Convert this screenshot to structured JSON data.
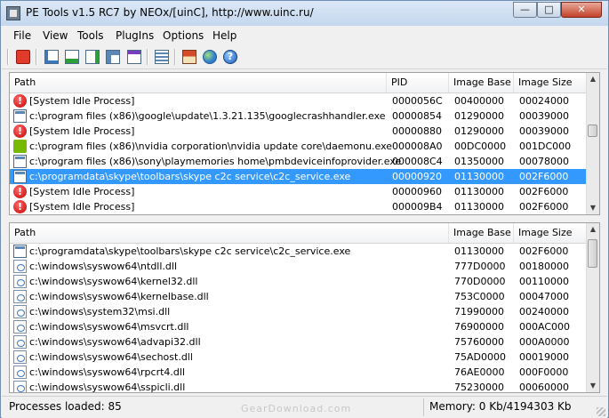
{
  "window": {
    "title": "PE Tools v1.5 RC7 by NEOx/[uinC], http://www.uinc.ru/",
    "minimize": "—",
    "maximize": "□",
    "close": "✕"
  },
  "menu": [
    "File",
    "View",
    "Tools",
    "PlugIns",
    "Options",
    "Help"
  ],
  "toolbar_icons": [
    "exit-icon",
    "edit-icon",
    "dump-icon",
    "rebuild-icon",
    "break-icon",
    "pe-editor-icon",
    "list-icon",
    "home-icon",
    "globe-icon",
    "help-icon"
  ],
  "process_list": {
    "headers": [
      "Path",
      "PID",
      "Image Base",
      "Image Size"
    ],
    "rows": [
      {
        "icon": "system-icon",
        "path": "[System Idle Process]",
        "pid": "0000056C",
        "base": "00400000",
        "size": "00024000"
      },
      {
        "icon": "app-window-icon",
        "path": "c:\\program files (x86)\\google\\update\\1.3.21.135\\googlecrashhandler.exe",
        "pid": "00000854",
        "base": "01290000",
        "size": "00039000"
      },
      {
        "icon": "system-icon",
        "path": "[System Idle Process]",
        "pid": "00000880",
        "base": "01290000",
        "size": "00039000"
      },
      {
        "icon": "nvidia-icon",
        "path": "c:\\program files (x86)\\nvidia corporation\\nvidia update core\\daemonu.exe",
        "pid": "000008A0",
        "base": "00DC0000",
        "size": "001DC000"
      },
      {
        "icon": "app-window-icon",
        "path": "c:\\program files (x86)\\sony\\playmemories home\\pmbdeviceinfoprovider.exe",
        "pid": "000008C4",
        "base": "01350000",
        "size": "00078000"
      },
      {
        "icon": "app-window-icon",
        "path": "c:\\programdata\\skype\\toolbars\\skype c2c service\\c2c_service.exe",
        "pid": "00000920",
        "base": "01130000",
        "size": "002F6000",
        "selected": true
      },
      {
        "icon": "system-icon",
        "path": "[System Idle Process]",
        "pid": "00000960",
        "base": "01130000",
        "size": "002F6000"
      },
      {
        "icon": "system-icon",
        "path": "[System Idle Process]",
        "pid": "000009B4",
        "base": "01130000",
        "size": "002F6000"
      }
    ]
  },
  "module_list": {
    "headers": [
      "Path",
      "Image Base",
      "Image Size"
    ],
    "rows": [
      {
        "icon": "app-window-icon",
        "path": "c:\\programdata\\skype\\toolbars\\skype c2c service\\c2c_service.exe",
        "base": "01130000",
        "size": "002F6000"
      },
      {
        "icon": "dll-icon",
        "path": "c:\\windows\\syswow64\\ntdll.dll",
        "base": "777D0000",
        "size": "00180000"
      },
      {
        "icon": "dll-icon",
        "path": "c:\\windows\\syswow64\\kernel32.dll",
        "base": "770D0000",
        "size": "00110000"
      },
      {
        "icon": "dll-icon",
        "path": "c:\\windows\\syswow64\\kernelbase.dll",
        "base": "753C0000",
        "size": "00047000"
      },
      {
        "icon": "dll-icon",
        "path": "c:\\windows\\system32\\msi.dll",
        "base": "71990000",
        "size": "00240000"
      },
      {
        "icon": "dll-icon",
        "path": "c:\\windows\\syswow64\\msvcrt.dll",
        "base": "76900000",
        "size": "000AC000"
      },
      {
        "icon": "dll-icon",
        "path": "c:\\windows\\syswow64\\advapi32.dll",
        "base": "75760000",
        "size": "000A0000"
      },
      {
        "icon": "dll-icon",
        "path": "c:\\windows\\syswow64\\sechost.dll",
        "base": "75AD0000",
        "size": "00019000"
      },
      {
        "icon": "dll-icon",
        "path": "c:\\windows\\syswow64\\rpcrt4.dll",
        "base": "76AE0000",
        "size": "000F0000"
      },
      {
        "icon": "dll-icon",
        "path": "c:\\windows\\syswow64\\sspicli.dll",
        "base": "75230000",
        "size": "00060000"
      }
    ]
  },
  "status": {
    "processes": "Processes loaded: 85",
    "memory": "Memory: 0 Kb/4194303 Kb"
  },
  "watermark": "GearDownload.com"
}
